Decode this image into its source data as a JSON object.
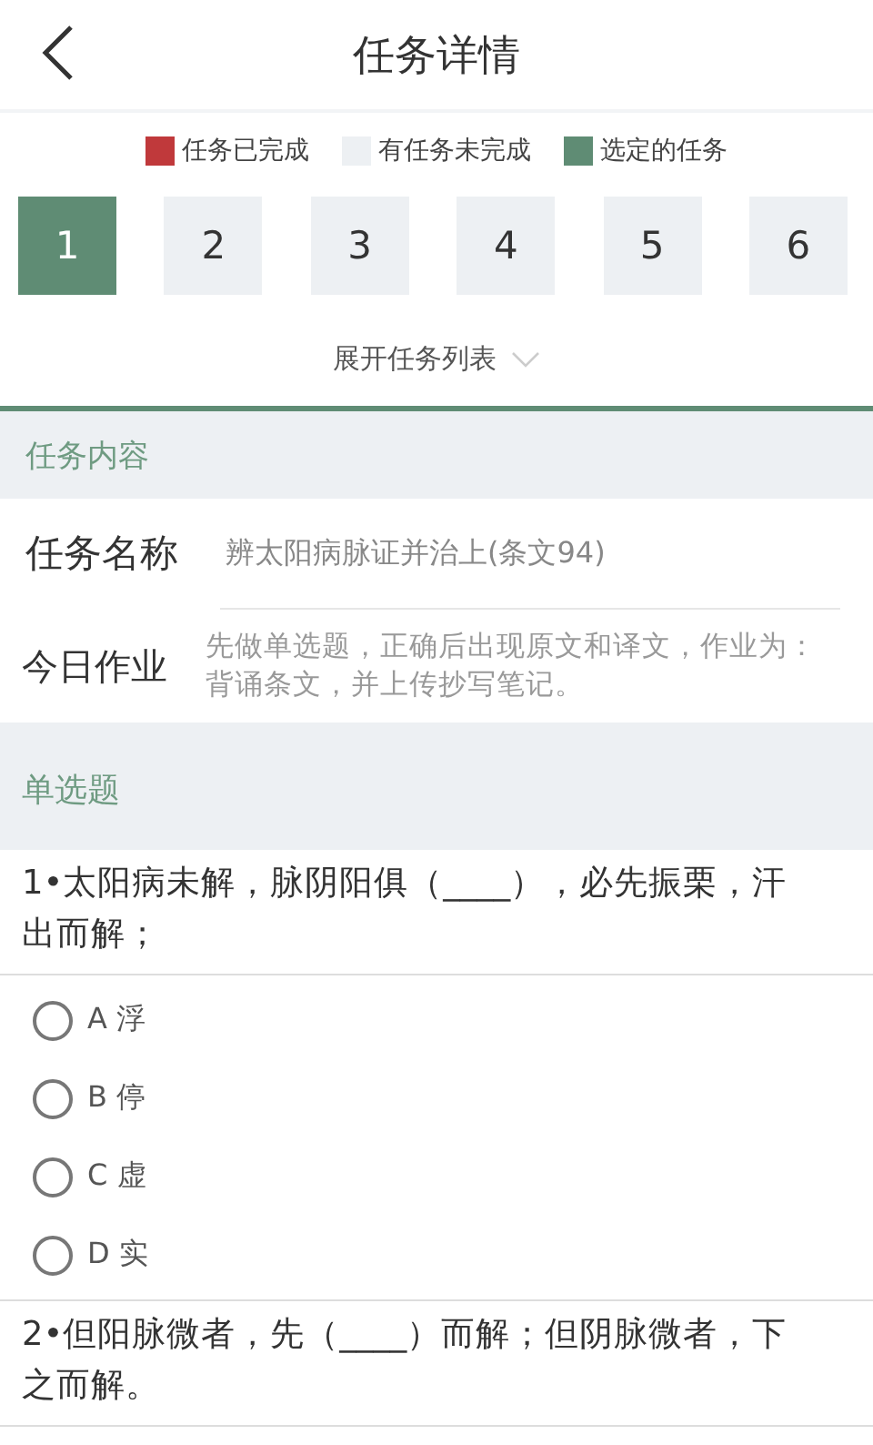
{
  "header": {
    "title": "任务详情"
  },
  "legend": [
    {
      "label": "任务已完成",
      "color": "#c0393b"
    },
    {
      "label": "有任务未完成",
      "color": "#edf0f3"
    },
    {
      "label": "选定的任务",
      "color": "#5f8c74"
    }
  ],
  "tasks": [
    {
      "label": "1",
      "selected": true
    },
    {
      "label": "2",
      "selected": false,
      "completed": false
    },
    {
      "label": "3",
      "selected": false,
      "completed": false
    },
    {
      "label": "4",
      "selected": false,
      "completed": false
    },
    {
      "label": "5",
      "selected": false,
      "completed": false
    },
    {
      "label": "6",
      "selected": false,
      "completed": false
    }
  ],
  "expand_link": "展开任务列表",
  "content_section": {
    "title": "任务内容",
    "name_label": "任务名称",
    "name_value": "辨太阳病脉证并治上(条文94)",
    "homework_label": "今日作业",
    "homework_value": "先做单选题，正确后出现原文和译文，作业为：背诵条文，并上传抄写笔记。"
  },
  "quiz_section": {
    "title": "单选题",
    "questions": [
      {
        "text": "1•太阳病未解，脉阴阳俱（____），必先振栗，汗出而解；",
        "options": [
          {
            "label": "A 浮",
            "selected": false
          },
          {
            "label": "B 停",
            "selected": false
          },
          {
            "label": "C 虚",
            "selected": false
          },
          {
            "label": "D 实",
            "selected": false
          }
        ]
      },
      {
        "text": "2•但阳脉微者，先（____）而解；但阴脉微者，下之而解。"
      }
    ]
  }
}
